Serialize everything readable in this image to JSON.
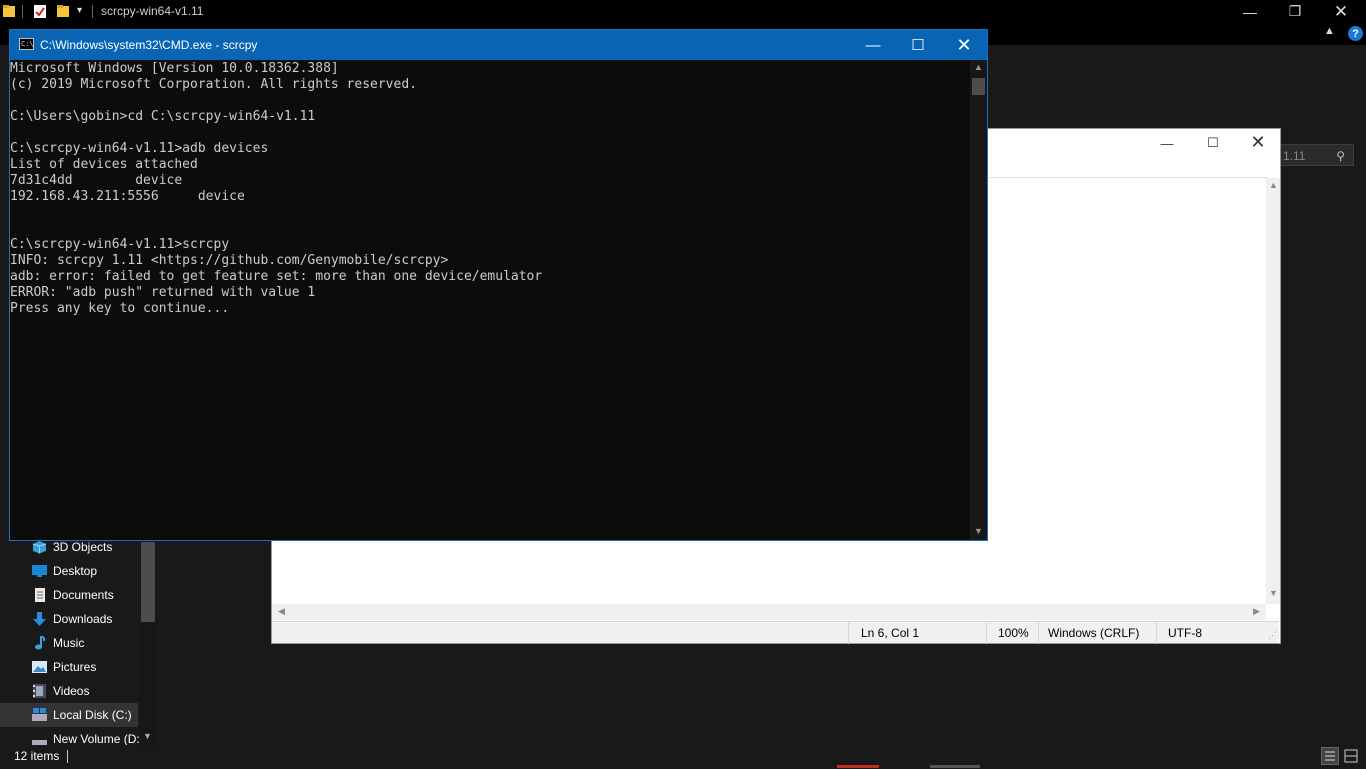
{
  "explorer": {
    "title": "scrcpy-win64-v1.11",
    "search_partial": "1.11",
    "nav_items": [
      {
        "label": "3D Objects",
        "icon": "3d-objects-icon",
        "selected": false
      },
      {
        "label": "Desktop",
        "icon": "desktop-folder-icon",
        "selected": false
      },
      {
        "label": "Documents",
        "icon": "documents-folder-icon",
        "selected": false
      },
      {
        "label": "Downloads",
        "icon": "downloads-folder-icon",
        "selected": false
      },
      {
        "label": "Music",
        "icon": "music-folder-icon",
        "selected": false
      },
      {
        "label": "Pictures",
        "icon": "pictures-folder-icon",
        "selected": false
      },
      {
        "label": "Videos",
        "icon": "videos-folder-icon",
        "selected": false
      },
      {
        "label": "Local Disk (C:)",
        "icon": "local-disk-icon",
        "selected": true
      },
      {
        "label": "New Volume (D:",
        "icon": "drive-icon",
        "selected": false
      }
    ],
    "status": {
      "item_count": "12 items"
    }
  },
  "notepad": {
    "status": {
      "position": "Ln 6, Col 1",
      "zoom": "100%",
      "line_ending": "Windows (CRLF)",
      "encoding": "UTF-8"
    }
  },
  "cmd": {
    "title": "C:\\Windows\\system32\\CMD.exe - scrcpy",
    "icon_text": "C:\\",
    "lines": [
      "Microsoft Windows [Version 10.0.18362.388]",
      "(c) 2019 Microsoft Corporation. All rights reserved.",
      "",
      "C:\\Users\\gobin>cd C:\\scrcpy-win64-v1.11",
      "",
      "C:\\scrcpy-win64-v1.11>adb devices",
      "List of devices attached",
      "7d31c4dd        device",
      "192.168.43.211:5556     device",
      "",
      "",
      "C:\\scrcpy-win64-v1.11>scrcpy",
      "INFO: scrcpy 1.11 <https://github.com/Genymobile/scrcpy>",
      "adb: error: failed to get feature set: more than one device/emulator",
      "ERROR: \"adb push\" returned with value 1",
      "Press any key to continue..."
    ]
  },
  "colors": {
    "cmd_titlebar": "#0a64b4",
    "cmd_background": "#0c0c0c",
    "cmd_text": "#cccccc",
    "explorer_background": "#191919",
    "folder_yellow": "#f5c542",
    "accent_blue": "#1a78d6"
  }
}
